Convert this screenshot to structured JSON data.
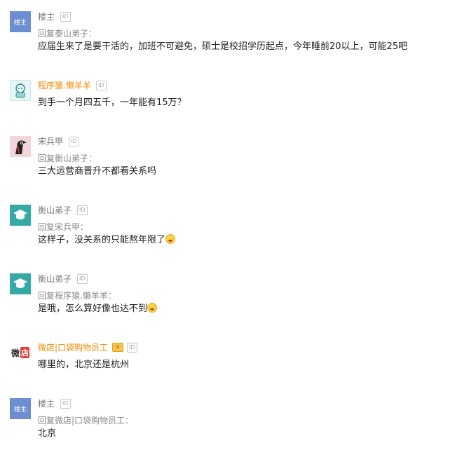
{
  "comments": [
    {
      "username": "楼主",
      "avatar_text": "楼主",
      "id_badge": "ID",
      "reply_to": "回复泰山弟子：",
      "text": "应届生来了是要干活的，加班不可避免，硕士是校招学历起点，今年睡前20以上，可能25吧"
    },
    {
      "username": "程序猿.懒羊羊",
      "id_badge": "ID",
      "text": "到手一个月四五千，一年能有15万？"
    },
    {
      "username": "宋兵甲",
      "id_badge": "ID",
      "reply_to": "回复衡山弟子：",
      "text": "三大运营商晋升不都看关系吗"
    },
    {
      "username": "衡山弟子",
      "id_badge": "ID",
      "reply_to": "回复宋兵甲：",
      "text": "这样子，没关系的只能熬年限了"
    },
    {
      "username": "衡山弟子",
      "id_badge": "ID",
      "reply_to": "回复程序猿.懒羊羊：",
      "text": "是哦，怎么算好像也达不到"
    },
    {
      "username": "微店|口袋购物员工",
      "id_badge": "ID",
      "avatar_text_1": "微",
      "avatar_text_2": "店",
      "text": "哪里的，北京还是杭州"
    },
    {
      "username": "楼主",
      "avatar_text": "楼主",
      "id_badge": "ID",
      "reply_to": "回复微店|口袋购物员工：",
      "text": "北京"
    }
  ],
  "colors": {
    "louzhu_avatar": "#6d8ed0",
    "hengshan_avatar": "#34a9a6",
    "vip_username": "#f08a00"
  },
  "icons": [
    "grin-emoji",
    "vip-badge-icon",
    "graduation-cap-icon",
    "woodpecker-icon",
    "coder-icon"
  ]
}
